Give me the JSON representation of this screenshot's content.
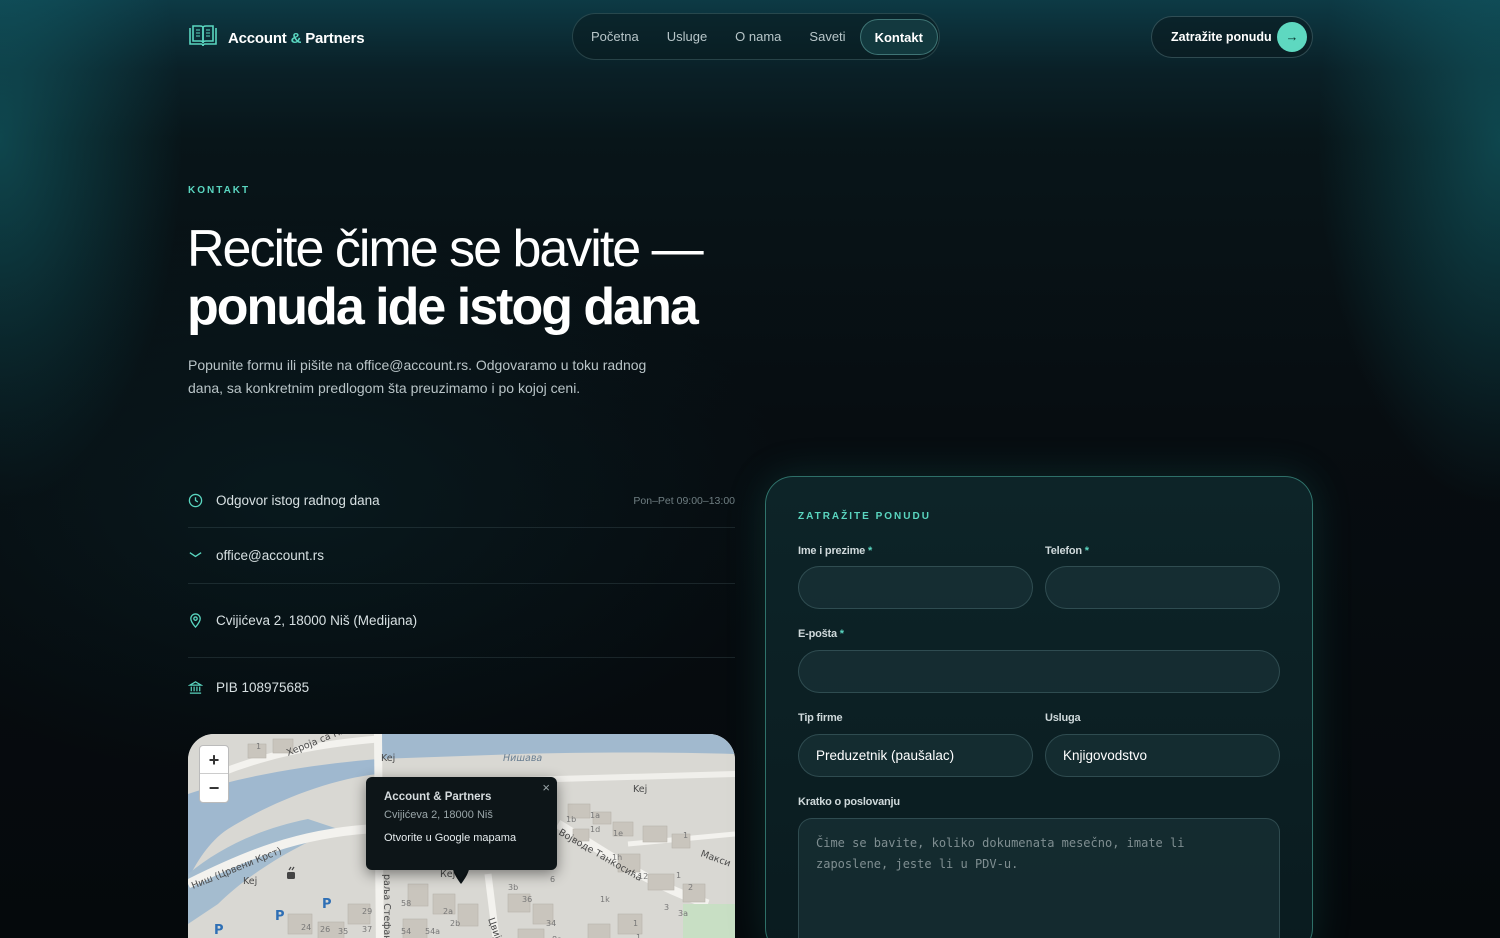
{
  "header": {
    "logo": {
      "name": "Account",
      "amp": "&",
      "suffix": "Partners",
      "icon": "book-icon"
    },
    "nav": [
      {
        "label": "Početna",
        "active": false
      },
      {
        "label": "Usluge",
        "active": false
      },
      {
        "label": "O nama",
        "active": false
      },
      {
        "label": "Saveti",
        "active": false
      },
      {
        "label": "Kontakt",
        "active": true
      }
    ],
    "cta": {
      "label": "Zatražite ponudu",
      "icon": "arrow-right-icon"
    }
  },
  "hero": {
    "eyebrow": "KONTAKT",
    "title_line1": "Recite čime se bavite —",
    "title_line2": "ponuda ide istog dana",
    "lead": "Popunite formu ili pišite na office@account.rs. Odgovaramo u toku radnog dana, sa konkretnim predlogom šta preuzimamo i po kojoj ceni."
  },
  "info": {
    "response": {
      "text": "Odgovor istog radnog dana",
      "meta": "Pon–Pet 09:00–13:00",
      "icon": "clock-icon"
    },
    "email": {
      "text": "office@account.rs",
      "icon": "chevron-down-icon"
    },
    "address": {
      "text": "Cvijićeva 2, 18000 Niš (Medijana)",
      "icon": "map-pin-icon"
    },
    "pib": {
      "text": "PIB 108975685",
      "icon": "bank-icon"
    }
  },
  "map": {
    "zoom_in": "+",
    "zoom_out": "−",
    "popup": {
      "title": "Account & Partners",
      "address": "Cvijićeva 2, 18000 Niš",
      "link": "Otvorite u Google mapama",
      "close": "×"
    },
    "labels": {
      "street1": "Хероја са Пл...",
      "kej1": "Kej",
      "nishava": "Нишава",
      "kej2": "Kej",
      "vojvode": "Војводе Танкосића",
      "maksim": "Макси",
      "cerveni": "Ниш (Црвени Крст)",
      "kej3": "Kej",
      "kej4": "Кеј",
      "stefan": "раља Стефана",
      "cvij": "Цвиј"
    },
    "house_numbers": [
      "1",
      "1b",
      "1a",
      "1d",
      "1e",
      "1",
      "1h",
      "12",
      "1k",
      "2",
      "3",
      "3a",
      "1",
      "2a",
      "2b",
      "3b",
      "36",
      "6",
      "58",
      "54",
      "54a",
      "34",
      "8a",
      "24",
      "26",
      "35",
      "29",
      "37",
      "P",
      "P",
      "P",
      "1",
      "1"
    ]
  },
  "form": {
    "title": "ZATRAŽITE PONUDU",
    "name_label": "Ime i prezime",
    "phone_label": "Telefon",
    "email_label": "E-pošta",
    "required_mark": "*",
    "company_type_label": "Tip firme",
    "company_type_value": "Preduzetnik (paušalac)",
    "service_label": "Usluga",
    "service_value": "Knjigovodstvo",
    "about_label": "Kratko o poslovanju",
    "about_placeholder": "Čime se bavite, koliko dokumenata mesečno, imate li zaposlene, jeste li u PDV-u."
  },
  "colors": {
    "accent": "#5ad6c0",
    "background": "#060c10"
  }
}
